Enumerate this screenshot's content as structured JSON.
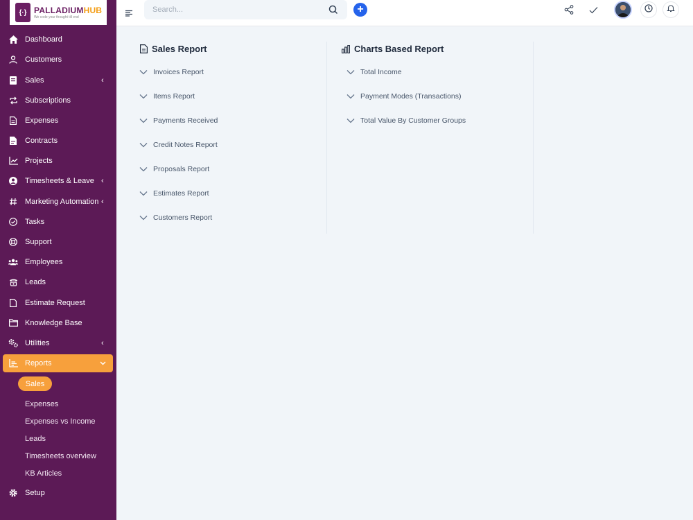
{
  "brand": {
    "mark": "{·}",
    "title_part1": "PALLADIUM",
    "title_part2": "HUB",
    "tagline": "We code your thought till end"
  },
  "sidebar": {
    "items": [
      {
        "label": "Dashboard",
        "icon": "home-icon"
      },
      {
        "label": "Customers",
        "icon": "user-icon"
      },
      {
        "label": "Sales",
        "icon": "receipt-icon",
        "chevron": "‹"
      },
      {
        "label": "Subscriptions",
        "icon": "repeat-icon"
      },
      {
        "label": "Expenses",
        "icon": "file-text-icon"
      },
      {
        "label": "Contracts",
        "icon": "contract-icon"
      },
      {
        "label": "Projects",
        "icon": "chart-line-icon"
      },
      {
        "label": "Timesheets & Leave",
        "icon": "user-circle-icon",
        "chevron": "‹"
      },
      {
        "label": "Marketing Automation",
        "icon": "hash-icon",
        "chevron": "‹"
      },
      {
        "label": "Tasks",
        "icon": "check-circle-icon"
      },
      {
        "label": "Support",
        "icon": "lifebuoy-icon"
      },
      {
        "label": "Employees",
        "icon": "users-icon"
      },
      {
        "label": "Leads",
        "icon": "phone-icon"
      },
      {
        "label": "Estimate Request",
        "icon": "file-icon"
      },
      {
        "label": "Knowledge Base",
        "icon": "folder-icon"
      },
      {
        "label": "Utilities",
        "icon": "cogs-icon",
        "chevron": "‹"
      },
      {
        "label": "Reports",
        "icon": "chart-area-icon",
        "chevron": "⌄"
      },
      {
        "label": "Setup",
        "icon": "gear-icon"
      }
    ],
    "reports_sub": {
      "active": "Sales",
      "items": [
        "Expenses",
        "Expenses vs Income",
        "Leads",
        "Timesheets overview",
        "KB Articles"
      ]
    }
  },
  "topbar": {
    "search_placeholder": "Search...",
    "plus_label": "+"
  },
  "sales_report": {
    "title": "Sales Report",
    "items": [
      "Invoices Report",
      "Items Report",
      "Payments Received",
      "Credit Notes Report",
      "Proposals Report",
      "Estimates Report",
      "Customers Report"
    ]
  },
  "charts_report": {
    "title": "Charts Based Report",
    "items": [
      "Total Income",
      "Payment Modes (Transactions)",
      "Total Value By Customer Groups"
    ]
  },
  "colors": {
    "sidebar_bg": "#5c1a56",
    "accent": "#f7a03c",
    "primary": "#2563eb",
    "content_bg": "#f1f5f9"
  }
}
